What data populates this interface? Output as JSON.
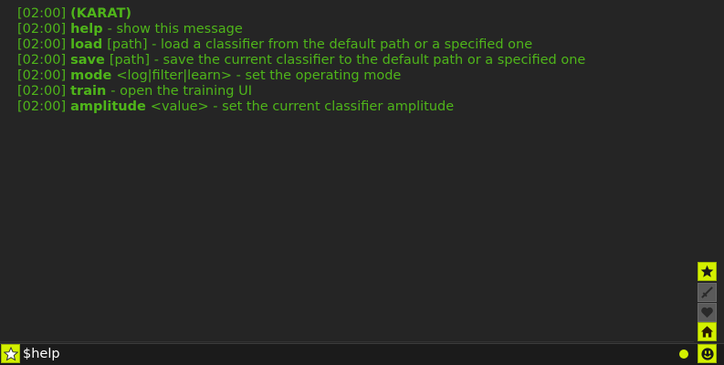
{
  "colors": {
    "background": "#252525",
    "log_text": "#4fb51a",
    "accent": "#d3f000",
    "input_text": "#ffffff"
  },
  "log": {
    "lines": [
      {
        "timestamp": "[02:00]",
        "command": "",
        "text": "(KARAT)"
      },
      {
        "timestamp": "[02:00]",
        "command": "help",
        "text": "- show this message"
      },
      {
        "timestamp": "[02:00]",
        "command": "load",
        "text": "[path] - load a classifier from the default path or a specified one"
      },
      {
        "timestamp": "[02:00]",
        "command": "save",
        "text": "[path] - save the current classifier to the default path or a specified one"
      },
      {
        "timestamp": "[02:00]",
        "command": "mode",
        "text": "<log|filter|learn> - set the operating mode"
      },
      {
        "timestamp": "[02:00]",
        "command": "train",
        "text": "- open the training UI"
      },
      {
        "timestamp": "[02:00]",
        "command": "amplitude",
        "text": "<value> - set the current classifier amplitude"
      }
    ]
  },
  "sidebar": {
    "buttons": [
      {
        "icon": "star-icon",
        "style": "accent"
      },
      {
        "icon": "sword-icon",
        "style": "muted"
      },
      {
        "icon": "heart-icon",
        "style": "muted"
      },
      {
        "icon": "home-icon",
        "style": "accent"
      }
    ]
  },
  "input": {
    "value": "$help"
  },
  "bottombar": {
    "left_icon": "star-outline-icon",
    "right_icon": "smiley-icon",
    "status": "online"
  }
}
